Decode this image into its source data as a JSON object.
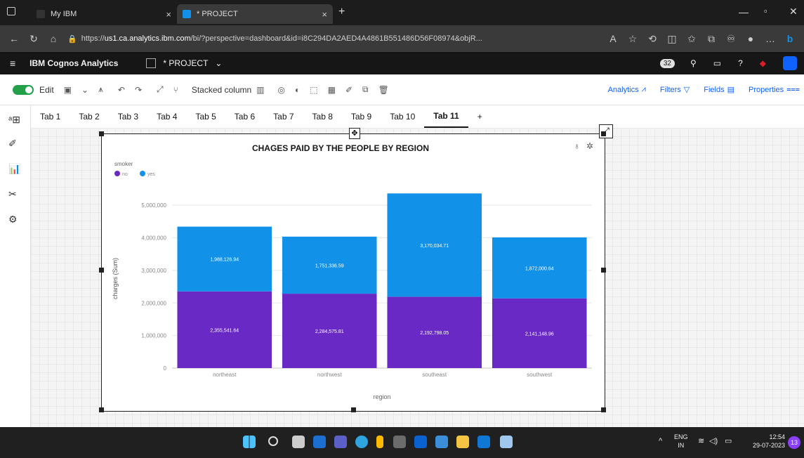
{
  "browser": {
    "tabs": [
      {
        "label": "My IBM",
        "close": "×"
      },
      {
        "label": "* PROJECT",
        "close": "×"
      }
    ],
    "new_tab": "+",
    "url_prefix": "https://",
    "url_domain": "us1.ca.analytics.ibm.com",
    "url_rest": "/bi/?perspective=dashboard&id=i8C294DA2AED4A4861B551486D56F08974&objR..."
  },
  "app": {
    "brand": "IBM Cognos Analytics",
    "project": "* PROJECT",
    "badge": "32"
  },
  "toolbar": {
    "edit_label": "Edit",
    "viz_label": "Stacked column",
    "analytics": "Analytics",
    "filters": "Filters",
    "fields": "Fields",
    "properties": "Properties"
  },
  "tabs": [
    "Tab 1",
    "Tab 2",
    "Tab 3",
    "Tab 4",
    "Tab 5",
    "Tab 6",
    "Tab 7",
    "Tab 8",
    "Tab 9",
    "Tab 10",
    "Tab 11"
  ],
  "active_tab": "Tab 11",
  "add_tab": "+",
  "chart_data": {
    "type": "bar",
    "stacked": true,
    "title": "CHAGES PAID BY THE PEOPLE BY REGION",
    "xlabel": "region",
    "ylabel": "charges (Sum)",
    "legend_title": "smoker",
    "legend_position": "top-left",
    "categories": [
      "northeast",
      "northwest",
      "southeast",
      "southwest"
    ],
    "series": [
      {
        "name": "no",
        "color": "#6929c4",
        "values": [
          2355541.64,
          2284575.81,
          2192798.05,
          2141148.96
        ],
        "labels": [
          "2,355,541.64",
          "2,284,575.81",
          "2,192,798.05",
          "2,141,148.96"
        ]
      },
      {
        "name": "yes",
        "color": "#1192e8",
        "values": [
          1988126.94,
          1751336.59,
          3170034.71,
          1872000.64
        ],
        "labels": [
          "1,988,126.94",
          "1,751,336.59",
          "3,170,034.71",
          "1,872,000.64"
        ]
      }
    ],
    "yticks": [
      "0",
      "1,000,000",
      "2,000,000",
      "3,000,000",
      "4,000,000",
      "5,000,000"
    ],
    "ylim": [
      0,
      5500000
    ],
    "grid": true
  },
  "taskbar": {
    "lang": "ENG",
    "region": "IN",
    "time": "12:54",
    "date": "29-07-2023",
    "notif": "13"
  },
  "colors": {
    "accent": "#0f62fe",
    "header": "#161616",
    "toggle": "#24a148"
  }
}
